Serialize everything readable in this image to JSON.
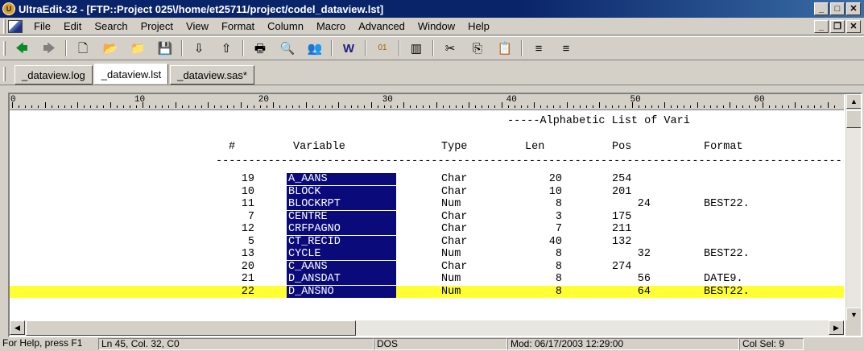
{
  "window": {
    "title": "UltraEdit-32 - [FTP::Project 025\\/home/et25711/project/codel_dataview.lst]",
    "app_icon": "uc-logo-icon"
  },
  "menu": [
    "File",
    "Edit",
    "Search",
    "Project",
    "View",
    "Format",
    "Column",
    "Macro",
    "Advanced",
    "Window",
    "Help"
  ],
  "toolbar": {
    "buttons": [
      {
        "name": "back-icon",
        "glyph": "🡄"
      },
      {
        "name": "forward-icon",
        "glyph": "🡆"
      },
      {
        "name": "new-file-icon",
        "glyph": "🗋"
      },
      {
        "name": "open-folder-icon",
        "glyph": "📂"
      },
      {
        "name": "open-file-icon",
        "glyph": "📁"
      },
      {
        "name": "save-icon",
        "glyph": "💾"
      },
      {
        "name": "ftp-open-icon",
        "glyph": "⇩"
      },
      {
        "name": "ftp-save-icon",
        "glyph": "⇧"
      },
      {
        "name": "print-icon",
        "glyph": "🖶"
      },
      {
        "name": "print-preview-icon",
        "glyph": "🔍"
      },
      {
        "name": "find-in-files-icon",
        "glyph": "👥"
      },
      {
        "name": "spell-check-icon",
        "glyph": "W"
      },
      {
        "name": "hex-mode-icon",
        "glyph": "01"
      },
      {
        "name": "column-mode-icon",
        "glyph": "▥"
      },
      {
        "name": "cut-icon",
        "glyph": "✂"
      },
      {
        "name": "copy-icon",
        "glyph": "⎘"
      },
      {
        "name": "paste-icon",
        "glyph": "📋"
      },
      {
        "name": "align-left-icon",
        "glyph": "≡"
      },
      {
        "name": "align-right-icon",
        "glyph": "≡"
      }
    ]
  },
  "tabs": [
    {
      "label": "_dataview.log",
      "active": false
    },
    {
      "label": "_dataview.lst",
      "active": true
    },
    {
      "label": "_dataview.sas*",
      "active": false
    }
  ],
  "ruler": {
    "labels": [
      "0",
      "10",
      "20",
      "30",
      "40",
      "50",
      "60"
    ]
  },
  "listing": {
    "title": "-----Alphabetic List of Vari",
    "headers": [
      "#",
      "Variable",
      "Type",
      "Len",
      "Pos",
      "Format"
    ],
    "divider": "-------------------------------------------------------------------------------------------------------",
    "rows": [
      {
        "num": "19",
        "var": "A_AANS",
        "type": "Char",
        "len": "20",
        "pos": "254",
        "fmt": "",
        "hl": false
      },
      {
        "num": "10",
        "var": "BLOCK",
        "type": "Char",
        "len": "10",
        "pos": "201",
        "fmt": "",
        "hl": false
      },
      {
        "num": "11",
        "var": "BLOCKRPT",
        "type": "Num",
        "len": "8",
        "pos": "24",
        "fmt": "BEST22.",
        "hl": false
      },
      {
        "num": "7",
        "var": "CENTRE",
        "type": "Char",
        "len": "3",
        "pos": "175",
        "fmt": "",
        "hl": false
      },
      {
        "num": "12",
        "var": "CRFPAGNO",
        "type": "Char",
        "len": "7",
        "pos": "211",
        "fmt": "",
        "hl": false
      },
      {
        "num": "5",
        "var": "CT_RECID",
        "type": "Char",
        "len": "40",
        "pos": "132",
        "fmt": "",
        "hl": false
      },
      {
        "num": "13",
        "var": "CYCLE",
        "type": "Num",
        "len": "8",
        "pos": "32",
        "fmt": "BEST22.",
        "hl": false
      },
      {
        "num": "20",
        "var": "C_AANS",
        "type": "Char",
        "len": "8",
        "pos": "274",
        "fmt": "",
        "hl": false
      },
      {
        "num": "21",
        "var": "D_ANSDAT",
        "type": "Num",
        "len": "8",
        "pos": "56",
        "fmt": "DATE9.",
        "hl": false
      },
      {
        "num": "22",
        "var": "D_ANSNO",
        "type": "Num",
        "len": "8",
        "pos": "64",
        "fmt": "BEST22.",
        "hl": true
      }
    ]
  },
  "status": {
    "help": "For Help, press F1",
    "position": "Ln 45, Col. 32, C0",
    "format": "DOS",
    "modified": "Mod: 06/17/2003 12:29:00",
    "col_sel": "Col Sel: 9"
  },
  "colors": {
    "title_bar": "#0a246a",
    "selection": "#0a0a7a",
    "current_line": "#ffff33"
  }
}
